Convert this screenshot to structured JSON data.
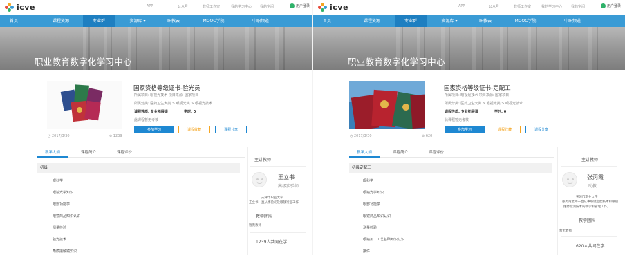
{
  "brand": {
    "logo_text": "icve",
    "logo_colors": [
      "#e84c3d",
      "#f5a623",
      "#3a9bd5",
      "#2fb26a"
    ]
  },
  "colors": {
    "nav_bg": "#3a9bd5",
    "nav_active": "#1e7fc1",
    "accent": "#1e88d2",
    "orange": "#f5a623",
    "login_green": "#2fb26a"
  },
  "pages": [
    {
      "top_links": {
        "app": "APP",
        "wechat": "公众号",
        "teacher": "教师工作室",
        "my_study": "我的学习中心",
        "my_space": "我的空间",
        "login": "用户登录"
      },
      "nav": [
        "首页",
        "课程资源",
        "专业群",
        "资源库 ▾",
        "职教云",
        "MOOC学院",
        "中职频道"
      ],
      "nav_active_index": 2,
      "banner_title": "职业教育数字化学习中心",
      "course": {
        "title": "国家资格等级证书-验光员",
        "meta1": "所属项目: 眼视光技术   项目来源: 国家项目",
        "meta2": "所属分类: 医药卫生大类 > 眼视光类 > 眼视光技术",
        "nature": "课程性质: 专业拓展课",
        "credit": "学时: 0",
        "hint": "此课程暂无考核",
        "date": "2017/3/30",
        "count": "1239",
        "btn_join": "参加学习",
        "btn_fav": "课程收藏",
        "btn_share": "课程分享"
      },
      "tabs": [
        "教学大纲",
        "课程简介",
        "课程评价"
      ],
      "chapter": "初级",
      "items": [
        "眼科学",
        "眼镜光学知识",
        "眼部功能学",
        "眼镜商品知识认识",
        "测量检验",
        "验光技术",
        "角膜接触镜知识"
      ],
      "side": {
        "title": "主讲教师",
        "teacher_name": "王立书",
        "teacher_title": "高级实验师",
        "desc1": "天津市职业大学",
        "desc2": "王立书一直从事验光及眼镜行业工作",
        "team_title": "教学团队",
        "team_none": "暂无教师",
        "learners": "1239人共同在学"
      }
    },
    {
      "top_links": {
        "app": "APP",
        "wechat": "公众号",
        "teacher": "教师工作室",
        "my_study": "我的学习中心",
        "my_space": "我的空间",
        "login": "用户登录"
      },
      "nav": [
        "首页",
        "课程资源",
        "专业群",
        "资源库 ▾",
        "职教云",
        "MOOC学院",
        "中职频道"
      ],
      "nav_active_index": 2,
      "banner_title": "职业教育数字化学习中心",
      "course": {
        "title": "国家资格等级证书-定配工",
        "meta1": "所属项目: 眼视光技术   项目来源: 国家项目",
        "meta2": "所属分类: 医药卫生大类 > 眼视光类 > 眼视光技术",
        "nature": "课程性质: 专业拓展课",
        "credit": "学时: 0",
        "hint": "此课程暂无考核",
        "date": "2017/3/30",
        "count": "620",
        "btn_join": "参加学习",
        "btn_fav": "课程收藏",
        "btn_share": "课程分享"
      },
      "tabs": [
        "教学大纲",
        "课程简介",
        "课程评价"
      ],
      "chapter": "初级定配工",
      "items": [
        "眼科学",
        "眼镜光学知识",
        "眼部功能学",
        "眼镜商品知识认识",
        "测量检验",
        "眼镜加工工艺基础知识认识",
        "接件"
      ],
      "side": {
        "title": "主讲教师",
        "teacher_name": "张丙霞",
        "teacher_title": "助教",
        "desc1": "天津市职业大学",
        "desc2": "张丙霞老师一直从事眼镜定配技术和眼镜",
        "desc3": "维修检测技术的教学和管理工作。",
        "team_title": "教学团队",
        "team_none": "暂无教师",
        "learners": "620人共同在学"
      }
    }
  ]
}
